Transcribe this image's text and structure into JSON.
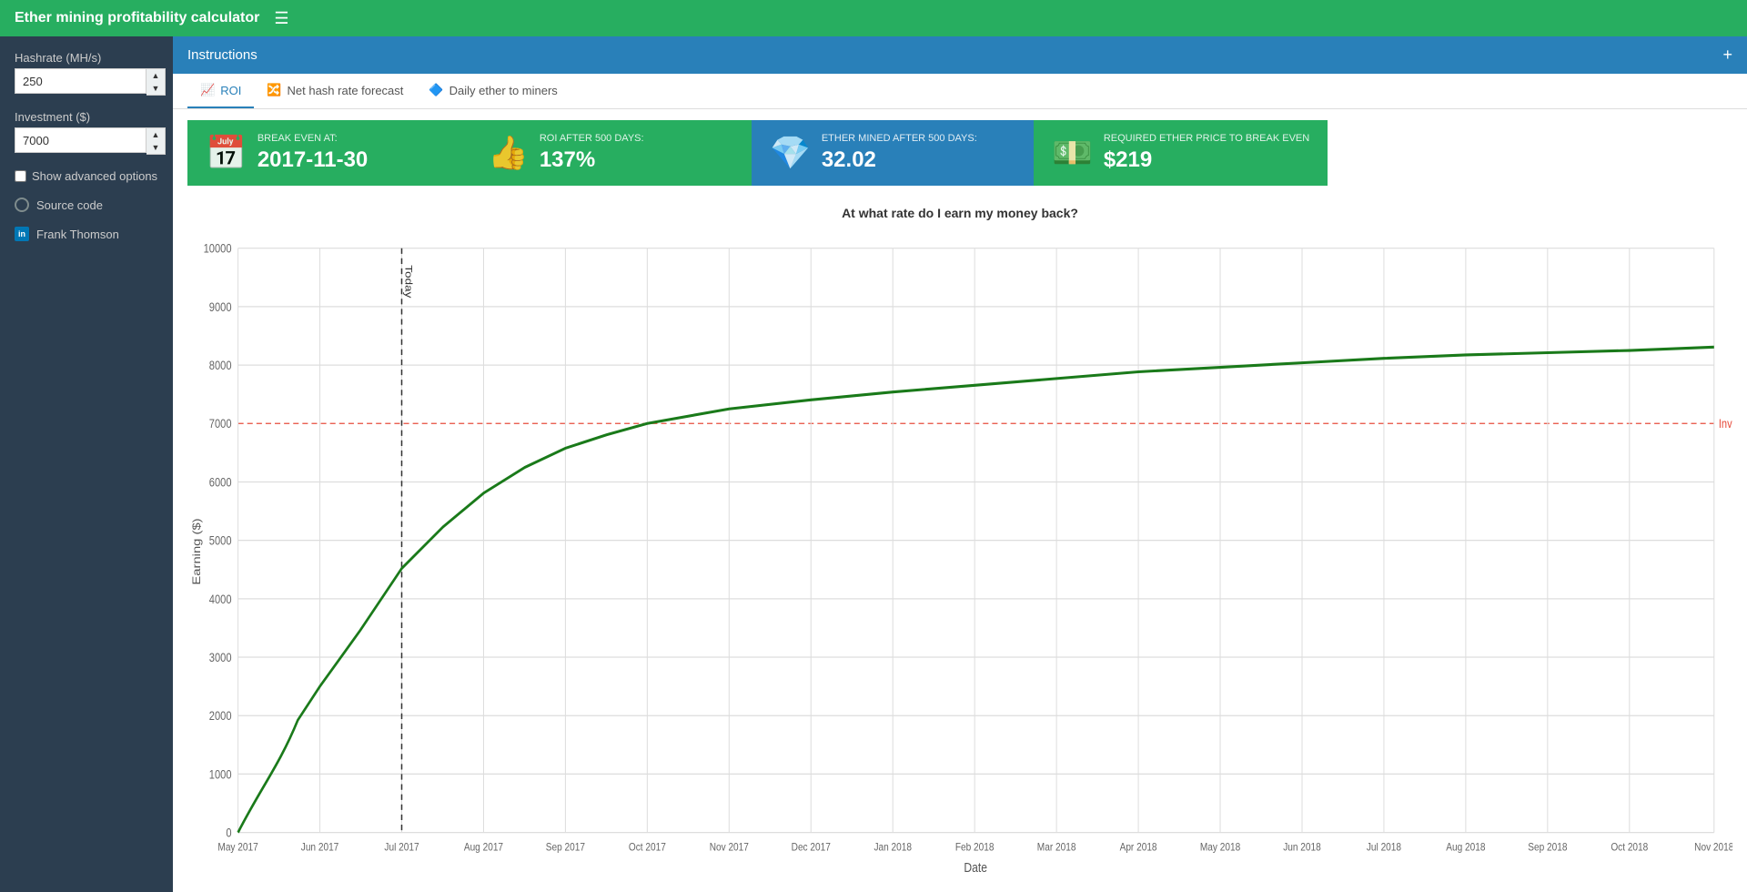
{
  "app": {
    "title": "Ether mining profitability calculator"
  },
  "sidebar": {
    "hashrate_label": "Hashrate (MH/s)",
    "hashrate_value": "250",
    "investment_label": "Investment ($)",
    "investment_value": "7000",
    "advanced_options_label": "Show advanced options",
    "source_code_label": "Source code",
    "author_label": "Frank Thomson"
  },
  "instructions": {
    "title": "Instructions",
    "expand_icon": "+"
  },
  "tabs": [
    {
      "id": "roi",
      "label": "ROI",
      "active": true
    },
    {
      "id": "nethash",
      "label": "Net hash rate forecast",
      "active": false
    },
    {
      "id": "daily",
      "label": "Daily ether to miners",
      "active": false
    }
  ],
  "stats": [
    {
      "id": "break_even",
      "color": "green",
      "icon": "📅",
      "label": "BREAK EVEN AT:",
      "value": "2017-11-30"
    },
    {
      "id": "roi",
      "color": "green",
      "icon": "👍",
      "label": "ROI AFTER 500 DAYS:",
      "value": "137%"
    },
    {
      "id": "ether_mined",
      "color": "blue",
      "icon": "💎",
      "label": "ETHER MINED AFTER 500 DAYS:",
      "value": "32.02"
    },
    {
      "id": "required_price",
      "color": "green",
      "icon": "💵",
      "label": "REQUIRED ETHER PRICE TO BREAK EVEN",
      "value": "$219"
    }
  ],
  "chart": {
    "title": "At what rate do I earn my money back?",
    "y_label": "Earning ($)",
    "x_label": "Date",
    "investment_line": 7000,
    "investment_label": "Investment",
    "today_label": "Today",
    "x_ticks": [
      "May 2017",
      "Jun 2017",
      "Jul 2017",
      "Aug 2017",
      "Sep 2017",
      "Oct 2017",
      "Nov 2017",
      "Dec 2017",
      "Jan 2018",
      "Feb 2018",
      "Mar 2018",
      "Apr 2018",
      "May 2018",
      "Jun 2018",
      "Jul 2018",
      "Aug 2018",
      "Sep 2018",
      "Oct 2018",
      "Nov 2018"
    ],
    "y_ticks": [
      0,
      1000,
      2000,
      3000,
      4000,
      5000,
      6000,
      7000,
      8000,
      9000,
      10000
    ]
  }
}
